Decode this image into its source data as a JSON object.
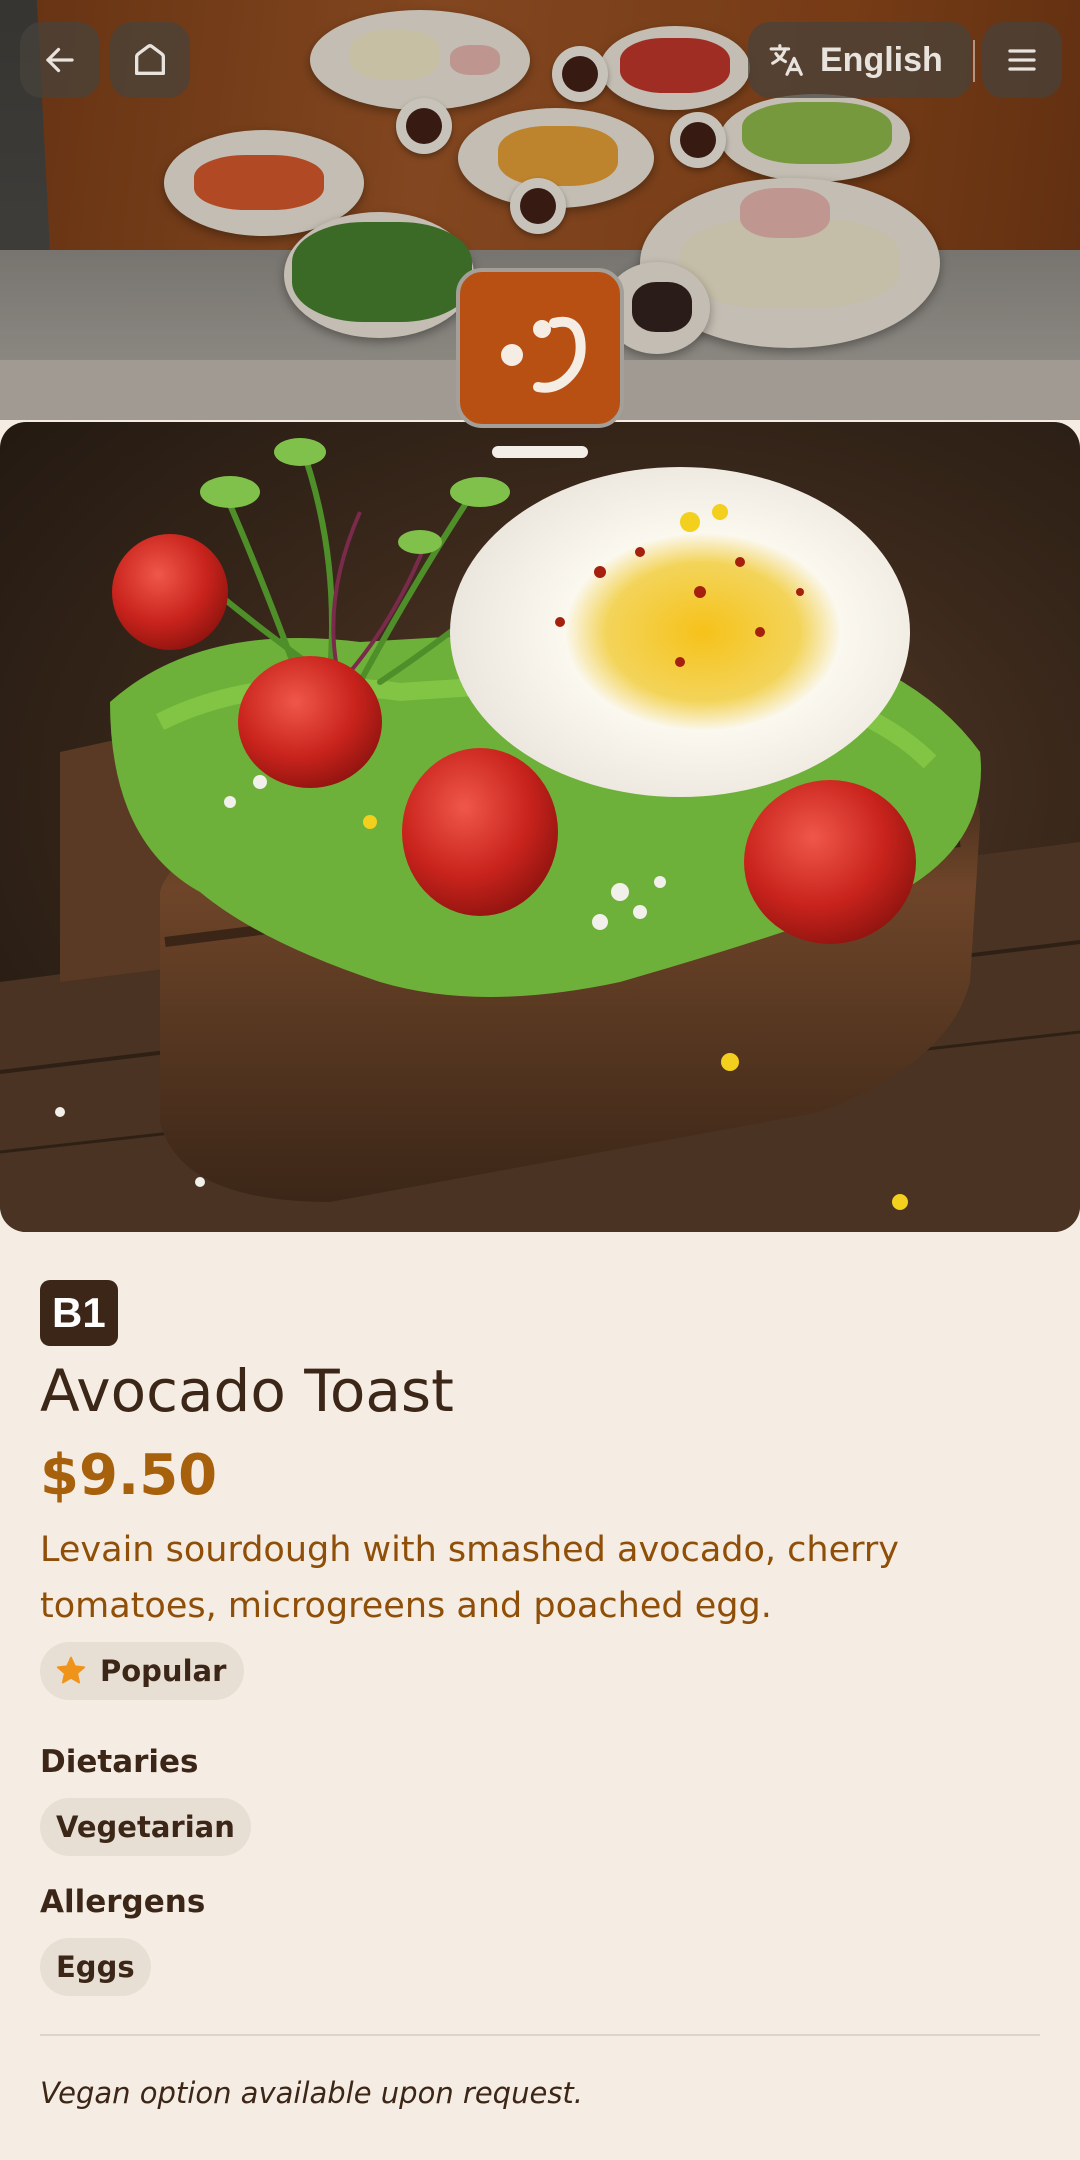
{
  "header": {
    "back_icon": "arrow-left-icon",
    "home_icon": "home-icon",
    "language": {
      "icon": "translate-icon",
      "label": "English"
    },
    "menu_icon": "hamburger-menu-icon"
  },
  "brand": {
    "logo_icon": "smiley-logo-icon",
    "color": "#b84f13"
  },
  "item": {
    "code": "B1",
    "name": "Avocado Toast",
    "price": "$9.50",
    "description": "Levain sourdough with smashed avocado, cherry tomatoes, microgreens and poached egg.",
    "badges": [
      {
        "icon": "star-icon",
        "label": "Popular"
      }
    ],
    "dietaries_heading": "Dietaries",
    "dietaries": [
      "Vegetarian"
    ],
    "allergens_heading": "Allergens",
    "allergens": [
      "Eggs"
    ],
    "note": "Vegan option available upon request."
  },
  "colors": {
    "background": "#f5ede3",
    "text_dark": "#3c2617",
    "price": "#a7600b",
    "description": "#8f4f08",
    "chip": "#e8dfd4",
    "star": "#f0931a"
  }
}
